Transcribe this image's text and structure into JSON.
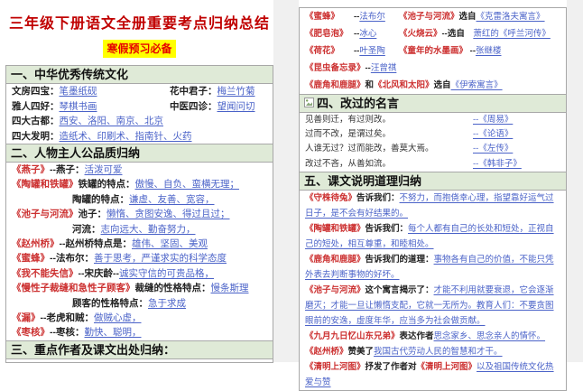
{
  "page": {
    "title": "三年级下册语文全册重要考点归纳总结",
    "badge": "寒假预习必备"
  },
  "colors": {
    "title_red": "#c00000",
    "badge_bg": "#ffff00",
    "badge_text": "#e60000",
    "book_title_red": "#cc3030",
    "answer_blue": "#4a62c8",
    "section_header_bg": "#dfead7",
    "table_border": "#a8a8a8"
  },
  "icons": {
    "s4_header_icon": "broken-image-icon"
  },
  "left": {
    "s1": {
      "header": "一、中华优秀传统文化",
      "rows": [
        {
          "cells": [
            {
              "w": 175,
              "parts": [
                {
                  "s": "l",
                  "x": "文房四宝："
                },
                {
                  "s": "a",
                  "x": "笔墨纸砚"
                }
              ]
            },
            {
              "parts": [
                {
                  "s": "l",
                  "x": "花中君子："
                },
                {
                  "s": "a",
                  "x": "梅兰竹菊"
                }
              ]
            }
          ]
        },
        {
          "cells": [
            {
              "w": 175,
              "parts": [
                {
                  "s": "l",
                  "x": "雅人四好："
                },
                {
                  "s": "a",
                  "x": "琴棋书画"
                }
              ]
            },
            {
              "parts": [
                {
                  "s": "l",
                  "x": "中医四诊："
                },
                {
                  "s": "a",
                  "x": "望闻问切"
                }
              ]
            }
          ]
        },
        {
          "cells": [
            {
              "parts": [
                {
                  "s": "l",
                  "x": "四大古都："
                },
                {
                  "s": "a",
                  "x": "西安、洛阳、南京、北京"
                }
              ]
            }
          ]
        },
        {
          "cells": [
            {
              "parts": [
                {
                  "s": "l",
                  "x": "四大发明："
                },
                {
                  "s": "a",
                  "x": "造纸术、印刷术、指南针、火药"
                }
              ]
            }
          ]
        }
      ]
    },
    "s2": {
      "header": "二、人物主人公品质归纳",
      "rows": [
        {
          "cells": [
            {
              "parts": [
                {
                  "s": "t",
                  "x": "《燕子》"
                },
                {
                  "s": "l",
                  "x": "--燕子："
                },
                {
                  "s": "a",
                  "x": "活泼可爱"
                }
              ]
            }
          ]
        },
        {
          "cells": [
            {
              "parts": [
                {
                  "s": "t",
                  "x": "《陶罐和铁罐》"
                },
                {
                  "s": "l",
                  "x": "铁罐的特点："
                },
                {
                  "s": "a",
                  "x": "傲慢、自负、蛮横无理；"
                }
              ]
            }
          ]
        },
        {
          "cells": [
            {
              "w": 67,
              "parts": []
            },
            {
              "parts": [
                {
                  "s": "l",
                  "x": "陶罐的特点："
                },
                {
                  "s": "a",
                  "x": "谦虚、友善、宽容，"
                }
              ]
            }
          ]
        },
        {
          "cells": [
            {
              "parts": [
                {
                  "s": "t",
                  "x": "《池子与河流》"
                },
                {
                  "s": "l",
                  "x": "池子："
                },
                {
                  "s": "a",
                  "x": "懒惰、贪图安逸、得过且过；"
                }
              ]
            }
          ]
        },
        {
          "cells": [
            {
              "w": 67,
              "parts": []
            },
            {
              "parts": [
                {
                  "s": "l",
                  "x": "河流："
                },
                {
                  "s": "a",
                  "x": "志向远大、勤奋努力，"
                }
              ]
            }
          ]
        },
        {
          "cells": [
            {
              "parts": [
                {
                  "s": "t",
                  "x": "《赵州桥》"
                },
                {
                  "s": "l",
                  "x": "--赵州桥特点是："
                },
                {
                  "s": "a",
                  "x": "雄伟、坚固、美观"
                }
              ]
            }
          ]
        },
        {
          "cells": [
            {
              "parts": [
                {
                  "s": "t",
                  "x": "《蜜蜂》"
                },
                {
                  "s": "l",
                  "x": "--法布尔："
                },
                {
                  "s": "a",
                  "x": "善于思考，严谨求实的科学态度"
                }
              ]
            }
          ]
        },
        {
          "cells": [
            {
              "parts": [
                {
                  "s": "t",
                  "x": "《我不能失信》"
                },
                {
                  "s": "l",
                  "x": "--宋庆龄--"
                },
                {
                  "s": "a",
                  "x": "诚实守信的可贵品格，"
                }
              ]
            }
          ]
        },
        {
          "cells": [
            {
              "parts": [
                {
                  "s": "t",
                  "x": "《慢性子裁缝和急性子顾客》"
                },
                {
                  "s": "l",
                  "x": "裁缝的性格特点："
                },
                {
                  "s": "a",
                  "x": "慢条斯理"
                }
              ]
            }
          ]
        },
        {
          "cells": [
            {
              "w": 67,
              "parts": []
            },
            {
              "parts": [
                {
                  "s": "l",
                  "x": "顾客的性格特点："
                },
                {
                  "s": "a",
                  "x": "急于求成"
                }
              ]
            }
          ]
        },
        {
          "cells": [
            {
              "parts": [
                {
                  "s": "t",
                  "x": "《漏》"
                },
                {
                  "s": "l",
                  "x": "--老虎和贼："
                },
                {
                  "s": "a",
                  "x": "做贼心虚，"
                }
              ]
            }
          ]
        },
        {
          "cells": [
            {
              "parts": [
                {
                  "s": "t",
                  "x": "《枣核》"
                },
                {
                  "s": "l",
                  "x": "--枣核："
                },
                {
                  "s": "a",
                  "x": "勤快、聪明，"
                }
              ]
            }
          ]
        }
      ]
    },
    "s3": {
      "header": "三、重点作者及课文出处归纳："
    }
  },
  "right": {
    "authors": {
      "rows": [
        {
          "cells": [
            {
              "w": 54,
              "parts": [
                {
                  "s": "t",
                  "x": "《蜜蜂》"
                }
              ]
            },
            {
              "w": 50,
              "parts": [
                {
                  "s": "l",
                  "x": "--"
                },
                {
                  "s": "a",
                  "x": "法布尔"
                }
              ]
            },
            {
              "parts": [
                {
                  "s": "t",
                  "x": "《池子与河流》"
                },
                {
                  "s": "l",
                  "x": "选自"
                },
                {
                  "s": "a",
                  "x": "《克雷洛夫寓言》"
                }
              ]
            }
          ]
        },
        {
          "cells": [
            {
              "w": 54,
              "parts": [
                {
                  "s": "t",
                  "x": "《肥皂泡》"
                }
              ]
            },
            {
              "w": 50,
              "parts": [
                {
                  "s": "l",
                  "x": "--"
                },
                {
                  "s": "a",
                  "x": "冰心"
                }
              ]
            },
            {
              "parts": [
                {
                  "s": "t",
                  "x": "《火烧云》"
                },
                {
                  "s": "l",
                  "x": "--选自　"
                },
                {
                  "s": "a",
                  "x": "萧红的《呼兰河传》"
                }
              ]
            }
          ]
        },
        {
          "cells": [
            {
              "w": 54,
              "parts": [
                {
                  "s": "t",
                  "x": "《荷花》"
                }
              ]
            },
            {
              "w": 50,
              "parts": [
                {
                  "s": "l",
                  "x": "--"
                },
                {
                  "s": "a",
                  "x": "叶圣陶"
                }
              ]
            },
            {
              "parts": [
                {
                  "s": "t",
                  "x": "《童年的水墨画》"
                },
                {
                  "s": "l",
                  "x": " --"
                },
                {
                  "s": "a",
                  "x": "张继楼"
                }
              ]
            }
          ]
        },
        {
          "cells": [
            {
              "parts": [
                {
                  "s": "t",
                  "x": "《昆虫备忘录》"
                },
                {
                  "s": "l",
                  "x": "--"
                },
                {
                  "s": "a",
                  "x": "汪曾祺"
                }
              ]
            }
          ]
        },
        {
          "cells": [
            {
              "parts": [
                {
                  "s": "t",
                  "x": "《鹿角和鹿腿》"
                },
                {
                  "s": "l",
                  "x": "和"
                },
                {
                  "s": "t",
                  "x": "《北风和太阳》"
                },
                {
                  "s": "l",
                  "x": "选自"
                },
                {
                  "s": "a",
                  "x": "《伊索寓言》"
                }
              ]
            }
          ]
        }
      ]
    },
    "s4": {
      "header": "四、改过的名言",
      "rows": [
        {
          "cells": [
            {
              "w": 186,
              "parts": [
                {
                  "s": "p",
                  "x": "见善则迁，有过则改。"
                }
              ]
            },
            {
              "parts": [
                {
                  "s": "a",
                  "x": "--《周易》"
                }
              ]
            }
          ]
        },
        {
          "cells": [
            {
              "w": 186,
              "parts": [
                {
                  "s": "p",
                  "x": "过而不改，是谓过矣。"
                }
              ]
            },
            {
              "parts": [
                {
                  "s": "a",
                  "x": "--《论语》"
                }
              ]
            }
          ]
        },
        {
          "cells": [
            {
              "w": 186,
              "parts": [
                {
                  "s": "p",
                  "x": "人谁无过？过而能改，善莫大焉。"
                }
              ]
            },
            {
              "parts": [
                {
                  "s": "a",
                  "x": "--《左传》"
                }
              ]
            }
          ]
        },
        {
          "cells": [
            {
              "w": 186,
              "parts": [
                {
                  "s": "p",
                  "x": "改过不吝，从善如流。"
                }
              ]
            },
            {
              "parts": [
                {
                  "s": "a",
                  "x": "--《韩非子》"
                }
              ]
            }
          ]
        }
      ]
    },
    "s5": {
      "header": "五、课文说明道理归纳",
      "paras": [
        {
          "parts": [
            {
              "s": "t",
              "x": "《守株待兔》"
            },
            {
              "s": "l",
              "x": "告诉我们："
            },
            {
              "s": "a",
              "x": "不努力，而抱侥幸心理，指望靠好运气过日子，是不会有好结果的。"
            }
          ]
        },
        {
          "parts": [
            {
              "s": "t",
              "x": "《陶罐和铁罐》"
            },
            {
              "s": "l",
              "x": "告诉我们："
            },
            {
              "s": "a",
              "x": "每个人都有自己的长处和短处，正视自己的短处，相互尊重，和睦相处。"
            }
          ]
        },
        {
          "parts": [
            {
              "s": "t",
              "x": "《鹿角和鹿腿》"
            },
            {
              "s": "l",
              "x": "告诉我们的道理："
            },
            {
              "s": "a",
              "x": "事物各有自己的价值，不能只凭外表去判断事物的好坏。"
            }
          ]
        },
        {
          "parts": [
            {
              "s": "t",
              "x": "《池子与河流》"
            },
            {
              "s": "l",
              "x": "这个寓言揭示了："
            },
            {
              "s": "a",
              "x": "才能不利用就要衰退，它会逐渐磨灭；才能一旦让懒惰支配，它就一无所为。教育人们：不要贪图眼前的安逸，虚度年华，应当多为社会做贡献。"
            }
          ]
        },
        {
          "parts": [
            {
              "s": "t",
              "x": "《九月九日忆山东兄弟》"
            },
            {
              "s": "l",
              "x": "表达作者"
            },
            {
              "s": "a",
              "x": "思念家乡、思念亲人的情怀。"
            }
          ]
        },
        {
          "parts": [
            {
              "s": "t",
              "x": "《赵州桥》"
            },
            {
              "s": "l",
              "x": "赞美了"
            },
            {
              "s": "a",
              "x": "我国古代劳动人民的智慧和才干。"
            }
          ]
        },
        {
          "parts": [
            {
              "s": "t",
              "x": "《清明上河图》"
            },
            {
              "s": "l",
              "x": "抒发了作者对"
            },
            {
              "s": "t",
              "x": "《清明上河图》"
            },
            {
              "s": "a",
              "x": "以及祖国传统文化热爱与赞"
            }
          ]
        }
      ]
    }
  }
}
